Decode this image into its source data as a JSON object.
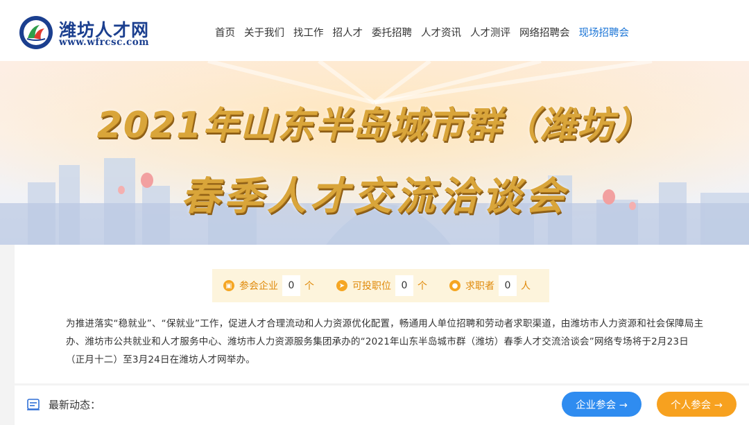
{
  "header": {
    "logo_title": "潍坊人才网",
    "logo_url": "www.wfrcsc.com",
    "nav": [
      {
        "label": "首页",
        "active": false
      },
      {
        "label": "关于我们",
        "active": false
      },
      {
        "label": "找工作",
        "active": false
      },
      {
        "label": "招人才",
        "active": false
      },
      {
        "label": "委托招聘",
        "active": false
      },
      {
        "label": "人才资讯",
        "active": false
      },
      {
        "label": "人才测评",
        "active": false
      },
      {
        "label": "网络招聘会",
        "active": false
      },
      {
        "label": "现场招聘会",
        "active": true
      }
    ]
  },
  "banner": {
    "line1": "2021年山东半岛城市群（潍坊）",
    "line2": "春季人才交流洽谈会"
  },
  "stats": {
    "companies": {
      "label": "参会企业",
      "value": "0",
      "unit": "个",
      "icon": "building-icon"
    },
    "positions": {
      "label": "可投职位",
      "value": "0",
      "unit": "个",
      "icon": "send-icon"
    },
    "seekers": {
      "label": "求职者",
      "value": "0",
      "unit": "人",
      "icon": "person-icon"
    }
  },
  "intro": "为推进落实“稳就业”、“保就业”工作，促进人才合理流动和人力资源优化配置，畅通用人单位招聘和劳动者求职渠道，由潍坊市人力资源和社会保障局主办、潍坊市公共就业和人才服务中心、潍坊市人力资源服务集团承办的“2021年山东半岛城市群（潍坊）春季人才交流洽谈会”网络专场将于2月23日（正月十二）至3月24日在潍坊人才网举办。",
  "bottom": {
    "news_label": "最新动态：",
    "company_button": "企业参会 →",
    "person_button": "个人参会 →"
  },
  "colors": {
    "brand_blue": "#1b3f8f",
    "active_nav": "#1a74d6",
    "stat_orange": "#e08a0b",
    "button_blue": "#2f8cf0",
    "button_orange": "#f7a11f"
  }
}
